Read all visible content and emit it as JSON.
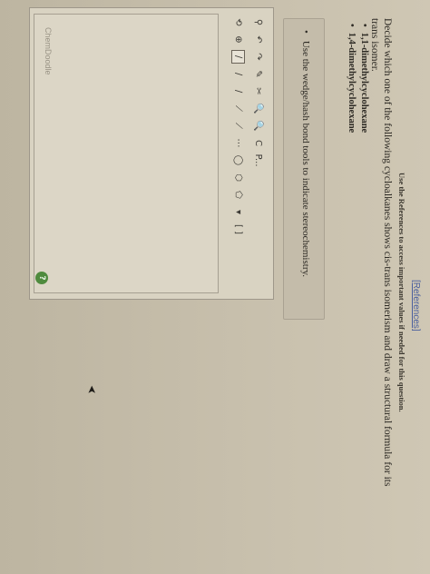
{
  "header": {
    "references_link": "[References]",
    "references_note": "Use the References to access important values if needed for this question."
  },
  "question": {
    "prompt": "Decide which one of the following cycloalkanes shows cis-trans isomerism and draw a structural formula for its trans isomer.",
    "options": [
      "1,1-dimethylcyclohexane",
      "1,4-dimethylcyclohexane"
    ]
  },
  "hint": {
    "text": "Use the wedge/hash bond tools to indicate stereochemistry."
  },
  "sketcher": {
    "watermark": "ChemDoodle",
    "help_glyph": "?",
    "toolbar_row1": [
      "⚲",
      "↶",
      "↷",
      "✎",
      "✂",
      "🔍",
      "🔍",
      "C",
      "P..."
    ],
    "toolbar_row2": [
      "⟲",
      "⊕",
      "∕",
      "∕",
      "∕",
      "⟋",
      "⟋",
      "⋯",
      "◯",
      "⬡",
      "⬠",
      "▾",
      "[ ]"
    ]
  }
}
